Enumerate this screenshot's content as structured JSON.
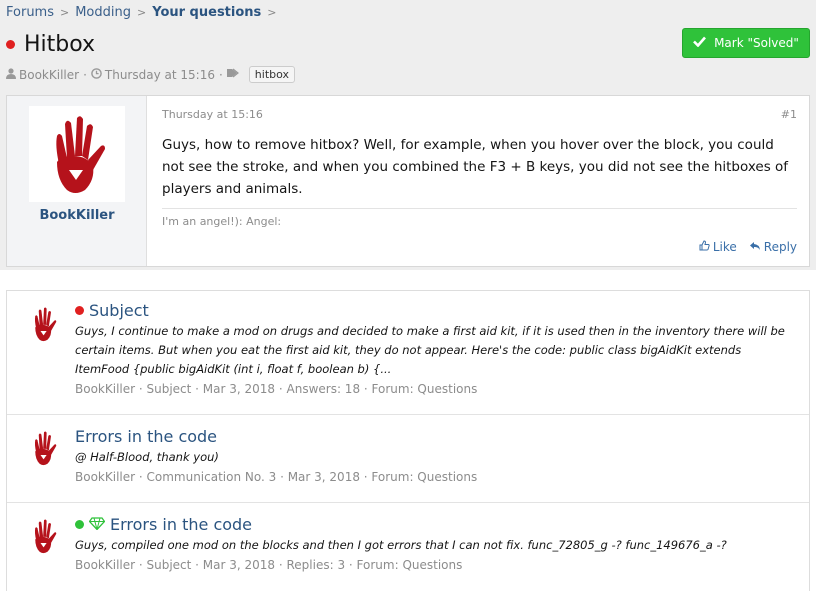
{
  "breadcrumbs": [
    {
      "label": "Forums"
    },
    {
      "label": "Modding"
    },
    {
      "label": "Your questions"
    }
  ],
  "thread": {
    "title": "Hitbox",
    "author": "BookKiller",
    "date": "Thursday at 15:16",
    "tag": "hitbox",
    "solved_button": "Mark \"Solved\""
  },
  "post": {
    "username": "BookKiller",
    "date": "Thursday at 15:16",
    "number": "#1",
    "body": "Guys, how to remove hitbox? Well, for example, when you hover over the block, you could not see the stroke, and when you combined the F3 + B keys, you did not see the hitboxes of players and animals.",
    "signature": "I'm an angel!): Angel:",
    "like_label": "Like",
    "reply_label": "Reply"
  },
  "similar_threads": [
    {
      "title": "Subject",
      "snippet": "Guys, I continue to make a mod on drugs and decided to make a first aid kit, if it is used then in the inventory there will be certain items. But when you eat the first aid kit, they do not appear. Here's the code: public class bigAidKit extends ItemFood {public bigAidKit (int i, float f, boolean b) {...",
      "meta": "BookKiller · Subject · Mar 3, 2018 · Answers: 18 · Forum: Questions"
    },
    {
      "title": "Errors in the code",
      "snippet": "@ Half-Blood, thank you)",
      "meta": "BookKiller · Communication No. 3 · Mar 3, 2018 · Forum: Questions"
    },
    {
      "title": "Errors in the code",
      "snippet": "Guys, compiled one mod on the blocks and then I got errors that I can not fix. func_72805_g -? func_149676_a -?",
      "meta": "BookKiller · Subject · Mar 3, 2018 · Replies: 3 · Forum: Questions"
    }
  ],
  "colors": {
    "link": "#2b5480",
    "solved_green": "#2fc23a",
    "unread_red": "#e02020",
    "hand_red": "#b5121b"
  }
}
